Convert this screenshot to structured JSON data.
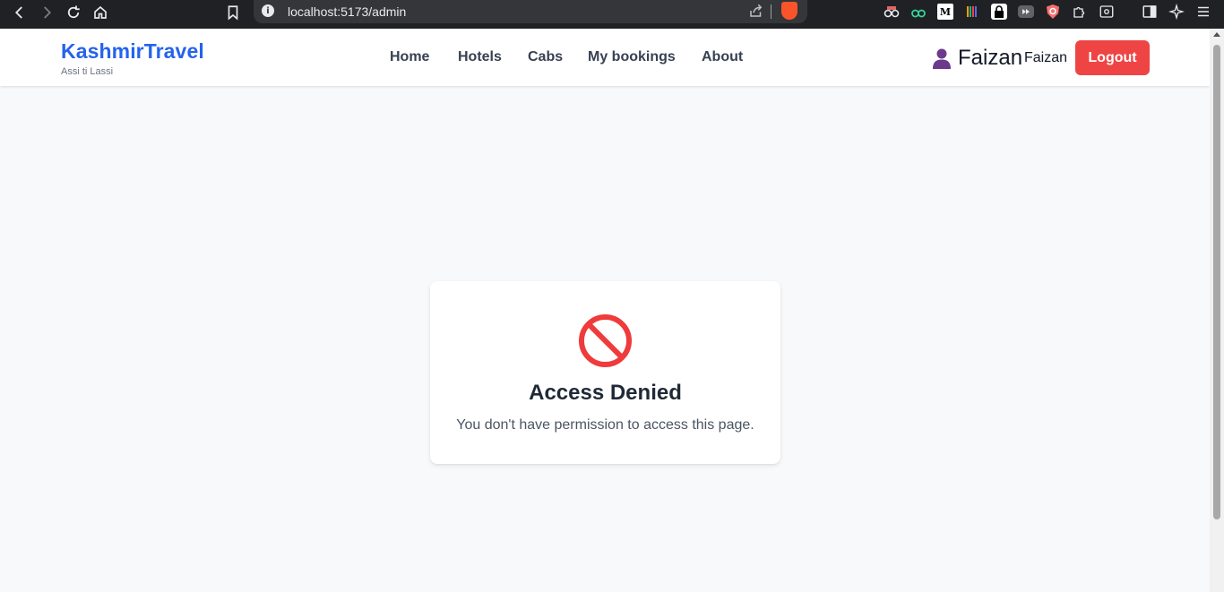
{
  "browser": {
    "url": "localhost:5173/admin"
  },
  "app": {
    "brand": "KashmirTravel",
    "tagline": "Assi ti Lassi",
    "nav": [
      {
        "label": "Home"
      },
      {
        "label": "Hotels"
      },
      {
        "label": "Cabs"
      },
      {
        "label": "My bookings"
      },
      {
        "label": "About"
      }
    ],
    "user": {
      "display_name": "Faizan",
      "name": "Faizan",
      "avatar_icon": "user-avatar-icon"
    },
    "logout_label": "Logout"
  },
  "card": {
    "icon": "no-entry-icon",
    "title": "Access Denied",
    "message": "You don't have permission to access this page."
  },
  "colors": {
    "brand": "#2563eb",
    "logout": "#ef4444",
    "deny_icon": "#ef4444",
    "background": "#f8f9fb"
  }
}
